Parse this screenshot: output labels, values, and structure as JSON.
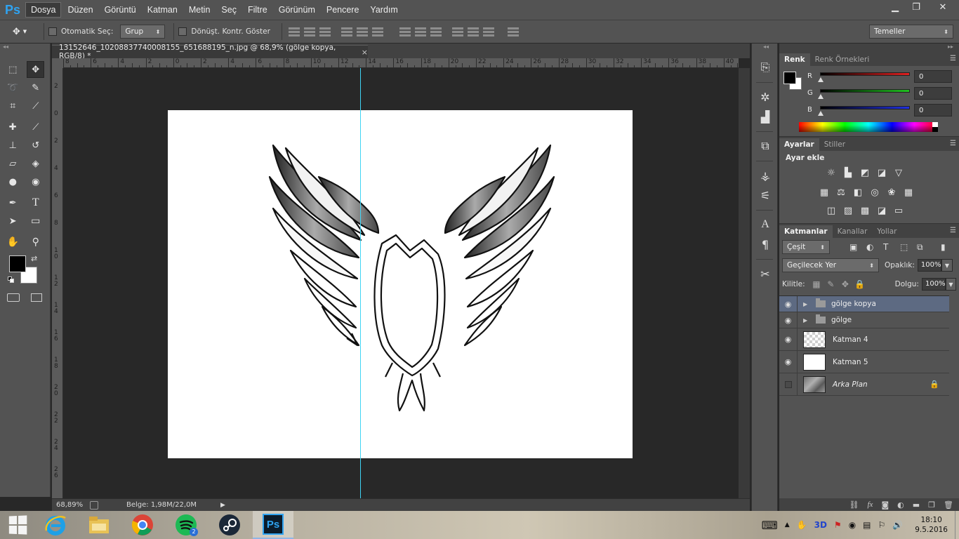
{
  "menu": {
    "logo": "Ps",
    "items": [
      "Dosya",
      "Düzen",
      "Görüntü",
      "Katman",
      "Metin",
      "Seç",
      "Filtre",
      "Görünüm",
      "Pencere",
      "Yardım"
    ],
    "win_min": "▁",
    "win_restore": "❐",
    "win_close": "✕"
  },
  "options": {
    "auto_select_label": "Otomatik Seç:",
    "auto_select_value": "Grup",
    "transform_label": "Dönüşt. Kontr. Göster",
    "workspace": "Temeller"
  },
  "document": {
    "tab_title": "13152646_10208837740008155_651688195_n.jpg @ 68,9% (gölge kopya, RGB/8) *",
    "tab_close": "×"
  },
  "rulers": {
    "horizontal": [
      "8",
      "6",
      "4",
      "2",
      "0",
      "2",
      "4",
      "6",
      "8",
      "10",
      "12",
      "14",
      "16",
      "18",
      "20",
      "22",
      "24",
      "26",
      "28",
      "30",
      "32",
      "34",
      "36",
      "38",
      "40"
    ],
    "vertical": [
      "2",
      "0",
      "2",
      "4",
      "6",
      "8",
      "10",
      "12",
      "14",
      "16",
      "18",
      "20",
      "22",
      "24",
      "26"
    ]
  },
  "status": {
    "zoom": "68,89%",
    "doc_info": "Belge: 1,98M/22,0M",
    "arrow": "▶"
  },
  "color_panel": {
    "tabs": [
      "Renk",
      "Renk Örnekleri"
    ],
    "channels": [
      {
        "label": "R",
        "value": "0",
        "color": "#e02020"
      },
      {
        "label": "G",
        "value": "0",
        "color": "#20c020"
      },
      {
        "label": "B",
        "value": "0",
        "color": "#2030e0"
      }
    ]
  },
  "adjustments_panel": {
    "tabs": [
      "Ayarlar",
      "Stiller"
    ],
    "title": "Ayar ekle"
  },
  "layers_panel": {
    "tabs": [
      "Katmanlar",
      "Kanallar",
      "Yollar"
    ],
    "filter_kind": "Çeşit",
    "blend_mode": "Geçilecek Yer",
    "opacity_label": "Opaklık:",
    "opacity_value": "100%",
    "lock_label": "Kilitle:",
    "fill_label": "Dolgu:",
    "fill_value": "100%",
    "layers": [
      {
        "name": "gölge kopya",
        "type": "group",
        "visible": true,
        "selected": true
      },
      {
        "name": "gölge",
        "type": "group",
        "visible": true,
        "selected": false
      },
      {
        "name": "Katman 4",
        "type": "layer",
        "visible": true,
        "thumb": "transparent"
      },
      {
        "name": "Katman 5",
        "type": "layer",
        "visible": true,
        "thumb": "white"
      },
      {
        "name": "Arka Plan",
        "type": "background",
        "visible": false,
        "thumb": "photo",
        "locked": true
      }
    ]
  },
  "taskbar": {
    "clock_time": "18:10",
    "clock_date": "9.5.2016",
    "spotify_badge": "2",
    "ps_label": "Ps"
  },
  "colors": {
    "accent_ps": "#2fa3f1",
    "guide": "#3fd4f4",
    "selected_layer": "#5d6a82"
  }
}
